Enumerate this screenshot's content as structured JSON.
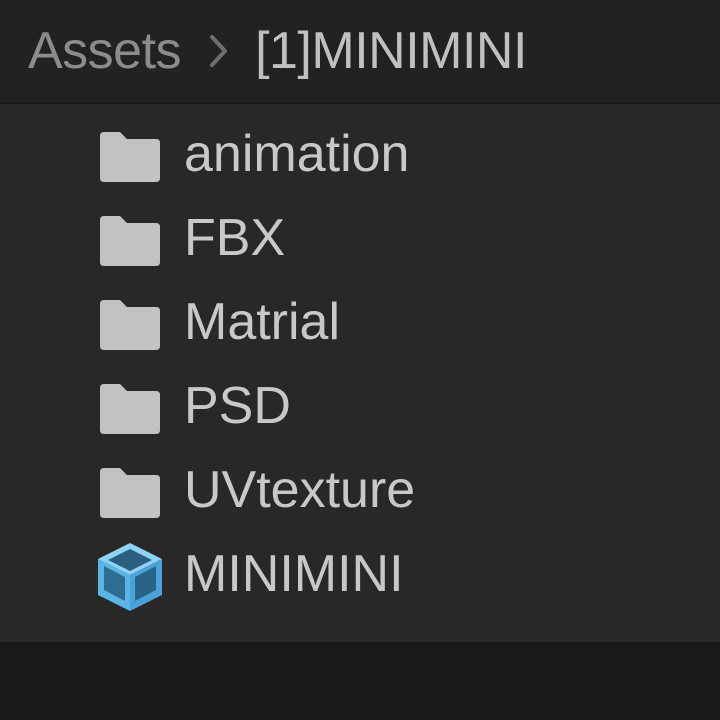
{
  "breadcrumb": {
    "root": "Assets",
    "separator_icon": "chevron-right-icon",
    "current": "[1]MINIMINI"
  },
  "items": [
    {
      "label": "animation",
      "icon": "folder-icon",
      "type": "folder"
    },
    {
      "label": "FBX",
      "icon": "folder-icon",
      "type": "folder"
    },
    {
      "label": "Matrial",
      "icon": "folder-icon",
      "type": "folder"
    },
    {
      "label": "PSD",
      "icon": "folder-icon",
      "type": "folder"
    },
    {
      "label": "UVtexture",
      "icon": "folder-icon",
      "type": "folder"
    },
    {
      "label": "MINIMINI",
      "icon": "prefab-cube-icon",
      "type": "prefab"
    }
  ],
  "colors": {
    "panel_bg": "#282828",
    "header_bg": "#222222",
    "text": "#c8c8c8",
    "folder_icon": "#c2c2c2",
    "prefab_icon": "#5ab4e6"
  }
}
